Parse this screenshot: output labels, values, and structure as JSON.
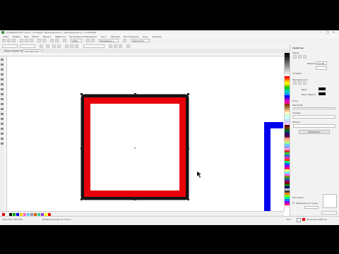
{
  "window": {
    "title": "CorelDRAW 2017 Home - Стандарт (Безымянный-1) - [Безымянный-1] - CorelDRAW",
    "minimize": "–",
    "maximize": "□",
    "close": "×"
  },
  "menu": [
    "Файл",
    "Правка",
    "Вид",
    "Макет",
    "Объект",
    "Эффекты",
    "Растровые изображения",
    "Текст",
    "Таблица",
    "Инструменты",
    "Окно",
    "Справка"
  ],
  "toolbar": {
    "zoom": "100%",
    "snap": "Привязать к",
    "launch": "Запустить"
  },
  "propbar": {
    "x": "",
    "y": ""
  },
  "tabs": [
    {
      "label": "Экран приветствия",
      "active": false
    },
    {
      "label": "Безымянный-1",
      "active": true
    }
  ],
  "docker": {
    "title": "Свойства",
    "section_outline": "Абрис",
    "width_label": "Ширина",
    "width_value": "2,0 мм",
    "section_fill": "Заливка",
    "section_transparency": "Прозрачность",
    "fill_color_label": "Цвет",
    "outline_color_label": "Цвет абриса",
    "corners_label": "Углы",
    "scale_label": "Масштаб",
    "section_summary": "Сводка",
    "object_label": "Объект",
    "apply_button": "Применить",
    "preview_label": "Просмотр",
    "checkbox_label": "Применить ко всем",
    "bottom_note": "Щелкните на объекте, чтобы отредактировать"
  },
  "status": {
    "coords": "(210,732; 135,145)",
    "hint": "Прямоугольник на слое 1",
    "fill_label": "Нет",
    "outline_label": "Красный 2,000 мм"
  },
  "colors": {
    "shape_fill": "#ffffff",
    "shape_outline": "#e8000a",
    "shape_outer": "#141414",
    "right_shape": "#0000ee"
  },
  "palette": [
    "#000000",
    "#1a1a1a",
    "#333333",
    "#4d4d4d",
    "#666666",
    "#808080",
    "#999999",
    "#b3b3b3",
    "#cccccc",
    "#e6e6e6",
    "#ffffff",
    "#ff0000",
    "#ff6600",
    "#ffcc00",
    "#ffff00",
    "#99cc00",
    "#00cc00",
    "#00cc99",
    "#00cccc",
    "#0099ff",
    "#0000ff",
    "#6600cc",
    "#cc00cc",
    "#ff0099",
    "#993300",
    "#996633",
    "#cc9966",
    "#ffcc99",
    "#ffffcc",
    "#ccffcc",
    "#ccffff",
    "#cce6ff",
    "#ccccff",
    "#ffccff",
    "#660000",
    "#663300",
    "#006600",
    "#003366",
    "#330066",
    "#660033",
    "#ff9999",
    "#ffcc66",
    "#99ff99",
    "#66ccff",
    "#9999ff",
    "#ff99cc",
    "#cc3333",
    "#33cc33",
    "#3366cc",
    "#cc33cc",
    "#ff3300",
    "#00ff66",
    "#0066ff",
    "#9900ff",
    "#ff0066",
    "#ffff66",
    "#66ffff",
    "#ff66ff",
    "#808000",
    "#008080",
    "#800080",
    "#800000",
    "#008000",
    "#000080",
    "#c0c0c0",
    "#404040",
    "#ff8000",
    "#80ff00",
    "#00ff80",
    "#0080ff",
    "#8000ff",
    "#ff0080"
  ],
  "bottom_palette": [
    "#e8000a",
    "#ffffff",
    "#000000",
    "#00aa00",
    "#0000ee",
    "#ffcc00",
    "#ff66cc",
    "#66ccff",
    "#999999",
    "#cc6600",
    "#33cc99",
    "#9933cc",
    "#ffff00",
    "#ff0000"
  ]
}
